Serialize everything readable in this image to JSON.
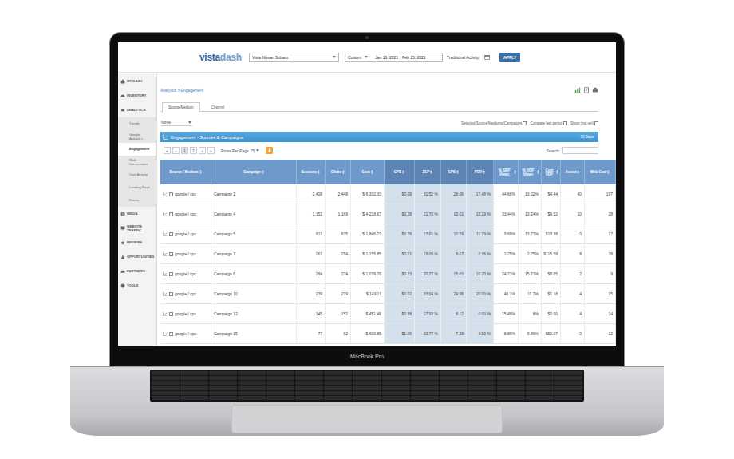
{
  "laptop": {
    "label": "MacBook Pro"
  },
  "header": {
    "logo": {
      "first": "vista",
      "second": "dash"
    },
    "dealer": "Vista Nissan Subaru",
    "range": "Custom",
    "date_from": "Jan 16, 2021",
    "date_to": "Feb 15, 2021",
    "activity": "Traditional Activity",
    "apply": "APPLY"
  },
  "sidebar": {
    "items": [
      {
        "label": "MY DASH",
        "selected": false,
        "expanded": false,
        "children": []
      },
      {
        "label": "INVENTORY",
        "selected": false,
        "expanded": false,
        "children": []
      },
      {
        "label": "ANALYTICS",
        "selected": false,
        "expanded": true,
        "children": [
          {
            "label": "Trends",
            "selected": false
          },
          {
            "label": "Google Analytics",
            "selected": false
          },
          {
            "label": "Engagement",
            "selected": true
          },
          {
            "label": "Web Conversions",
            "selected": false
          },
          {
            "label": "User Activity",
            "selected": false
          },
          {
            "label": "Landing Page",
            "selected": false
          },
          {
            "label": "Events",
            "selected": false
          }
        ]
      },
      {
        "label": "MEDIA",
        "selected": false,
        "expanded": false,
        "children": []
      },
      {
        "label": "WEBSITE TRAFFIC",
        "selected": false,
        "expanded": false,
        "children": []
      },
      {
        "label": "REVIEWS",
        "selected": false,
        "expanded": false,
        "children": []
      },
      {
        "label": "OPPORTUNITIES",
        "selected": false,
        "expanded": false,
        "children": []
      },
      {
        "label": "PARTNERS",
        "selected": false,
        "expanded": false,
        "children": []
      },
      {
        "label": "TOOLS",
        "selected": false,
        "expanded": false,
        "children": []
      }
    ]
  },
  "breadcrumb": "Analytics > Engagement",
  "tabs": [
    {
      "label": "Source/Medium",
      "selected": true
    },
    {
      "label": "Channel",
      "selected": false
    }
  ],
  "filter": {
    "value": "None"
  },
  "options": [
    {
      "label": "Selected Source/Mediums/Campaigns",
      "checked": false
    },
    {
      "label": "Compare last period",
      "checked": false
    },
    {
      "label": "Show (not set)",
      "checked": false
    }
  ],
  "panel": {
    "title": "Engagement - Sources & Campaigns",
    "period": "30 Days"
  },
  "pagination": {
    "buttons": [
      {
        "label": "«",
        "selected": false
      },
      {
        "label": "‹",
        "selected": false
      },
      {
        "label": "1",
        "selected": true
      },
      {
        "label": "2",
        "selected": false
      },
      {
        "label": "›",
        "selected": false
      },
      {
        "label": "»",
        "selected": false
      }
    ],
    "rows_label": "Rows Per Page",
    "rows_value": "25"
  },
  "search": {
    "label": "Search:"
  },
  "table": {
    "columns": [
      {
        "label": "Source / Medium",
        "highlighted": false
      },
      {
        "label": "Campaign",
        "highlighted": false
      },
      {
        "label": "Sessions",
        "highlighted": false
      },
      {
        "label": "Clicks",
        "highlighted": false
      },
      {
        "label": "Cost",
        "highlighted": false
      },
      {
        "label": "CPS",
        "highlighted": true
      },
      {
        "label": "ZEP",
        "highlighted": true
      },
      {
        "label": "EPS",
        "highlighted": true
      },
      {
        "label": "PER",
        "highlighted": true
      },
      {
        "label": "% SRP Views",
        "highlighted": false
      },
      {
        "label": "% VDP Views",
        "highlighted": false
      },
      {
        "label": "Cost VDP",
        "highlighted": false
      },
      {
        "label": "Assist",
        "highlighted": false
      },
      {
        "label": "Web Goal",
        "highlighted": false
      }
    ],
    "rows": [
      {
        "checked": false,
        "cells": [
          "google / cpc",
          "Campaign 2",
          "2,408",
          "2,448",
          "$ 6,332.33",
          "$0.09",
          "31.52 %",
          "28.06",
          "17.48 %",
          "44.66%",
          "13.02%",
          "$4.44",
          "40",
          "197"
        ]
      },
      {
        "checked": false,
        "cells": [
          "google / cpc",
          "Campaign 4",
          "1,152",
          "1,169",
          "$ 4,218.67",
          "$0.28",
          "21.70 %",
          "13.01",
          "15.19 %",
          "33.44%",
          "13.24%",
          "$9.52",
          "10",
          "28"
        ]
      },
      {
        "checked": false,
        "cells": [
          "google / cpc",
          "Campaign 5",
          "611",
          "635",
          "$ 1,846.22",
          "$0.29",
          "13.91 %",
          "10.59",
          "11.29 %",
          "9.68%",
          "13.77%",
          "$13.38",
          "0",
          "17"
        ]
      },
      {
        "checked": false,
        "cells": [
          "google / cpc",
          "Campaign 7",
          "262",
          "294",
          "$ 1,155.85",
          "$0.51",
          "19.08 %",
          "8.67",
          "0.36 %",
          "2.25%",
          "2.25%",
          "$115.59",
          "8",
          "28"
        ]
      },
      {
        "checked": false,
        "cells": [
          "google / cpc",
          "Campaign 6",
          "284",
          "274",
          "$ 1,039.76",
          "$0.23",
          "20.77 %",
          "15.63",
          "16.20 %",
          "24.71%",
          "15.21%",
          "$8.65",
          "2",
          "9"
        ]
      },
      {
        "checked": false,
        "cells": [
          "google / cpc",
          "Campaign 10",
          "239",
          "219",
          "$ 149.11",
          "$0.02",
          "33.04 %",
          "29.96",
          "20.00 %",
          "46.1%",
          "11.7%",
          "$1.18",
          "4",
          "15"
        ]
      },
      {
        "checked": false,
        "cells": [
          "google / cpc",
          "Campaign 12",
          "145",
          "152",
          "$ 451.46",
          "$0.38",
          "17.93 %",
          "8.12",
          "0.00 %",
          "15.48%",
          "8%",
          "$0.00",
          "4",
          "14"
        ]
      },
      {
        "checked": false,
        "cells": [
          "google / cpc",
          "Campaign 15",
          "77",
          "82",
          "$ 600.85",
          "$1.06",
          "33.77 %",
          "7.36",
          "3.90 %",
          "8.89%",
          "8.89%",
          "$50.07",
          "0",
          "12"
        ]
      }
    ]
  }
}
